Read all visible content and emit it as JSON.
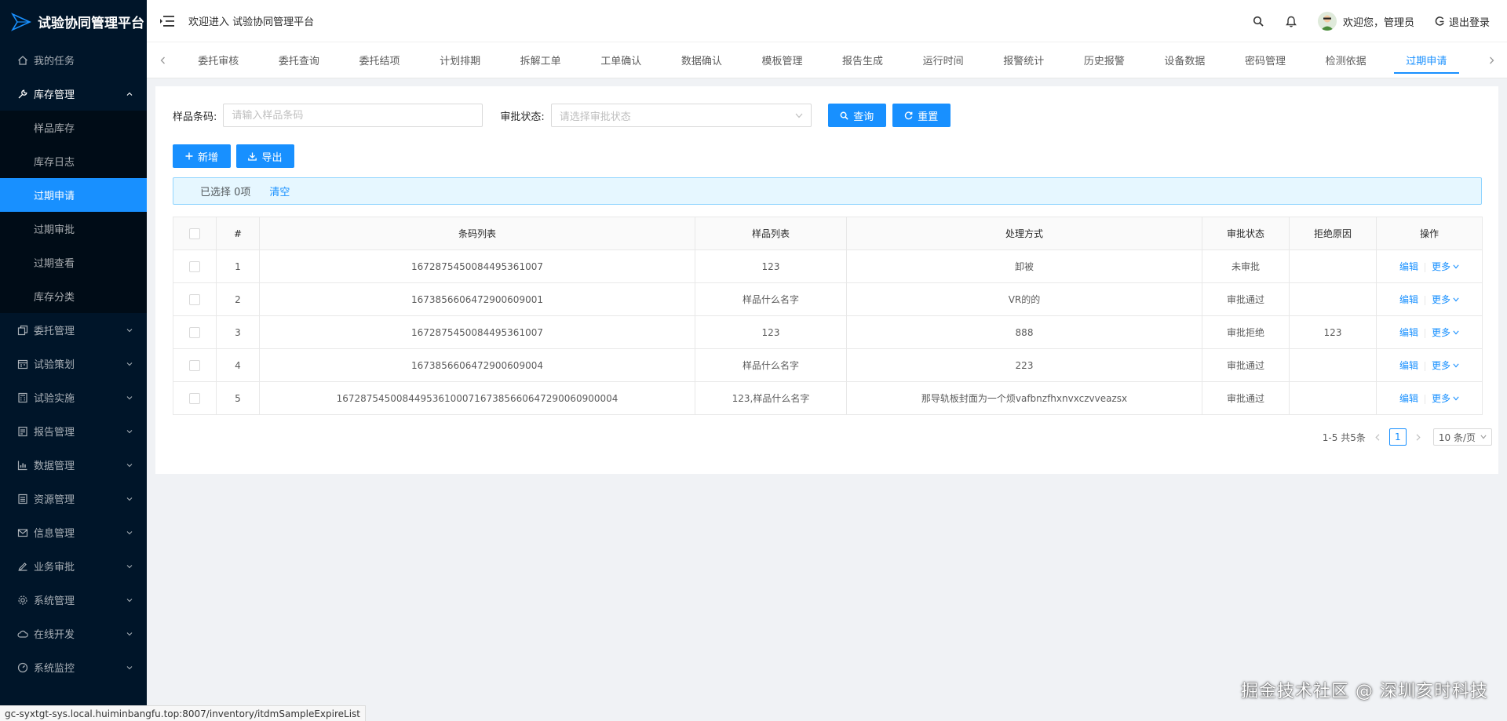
{
  "app": {
    "title": "试验协同管理平台"
  },
  "sidebar": {
    "items": [
      {
        "label": "我的任务",
        "icon": "home-icon",
        "expandable": false
      },
      {
        "label": "库存管理",
        "icon": "wrench-icon",
        "expandable": true,
        "open": true,
        "children": [
          {
            "label": "样品库存",
            "active": false
          },
          {
            "label": "库存日志",
            "active": false
          },
          {
            "label": "过期申请",
            "active": true
          },
          {
            "label": "过期审批",
            "active": false
          },
          {
            "label": "过期查看",
            "active": false
          },
          {
            "label": "库存分类",
            "active": false
          }
        ]
      },
      {
        "label": "委托管理",
        "icon": "copy-icon",
        "expandable": true
      },
      {
        "label": "试验策划",
        "icon": "calendar-icon",
        "expandable": true
      },
      {
        "label": "试验实施",
        "icon": "calculator-icon",
        "expandable": true
      },
      {
        "label": "报告管理",
        "icon": "report-icon",
        "expandable": true
      },
      {
        "label": "数据管理",
        "icon": "chart-icon",
        "expandable": true
      },
      {
        "label": "资源管理",
        "icon": "list-icon",
        "expandable": true
      },
      {
        "label": "信息管理",
        "icon": "mail-icon",
        "expandable": true
      },
      {
        "label": "业务审批",
        "icon": "signature-icon",
        "expandable": true
      },
      {
        "label": "系统管理",
        "icon": "gear-icon",
        "expandable": true
      },
      {
        "label": "在线开发",
        "icon": "cloud-icon",
        "expandable": true
      },
      {
        "label": "系统监控",
        "icon": "dashboard-icon",
        "expandable": true
      }
    ]
  },
  "header": {
    "welcome": "欢迎进入 试验协同管理平台",
    "user_greeting": "欢迎您，管理员",
    "logout_label": "退出登录"
  },
  "tabs": [
    {
      "label": "委托审核",
      "active": false
    },
    {
      "label": "委托查询",
      "active": false
    },
    {
      "label": "委托结项",
      "active": false
    },
    {
      "label": "计划排期",
      "active": false
    },
    {
      "label": "拆解工单",
      "active": false
    },
    {
      "label": "工单确认",
      "active": false
    },
    {
      "label": "数据确认",
      "active": false
    },
    {
      "label": "模板管理",
      "active": false
    },
    {
      "label": "报告生成",
      "active": false
    },
    {
      "label": "运行时间",
      "active": false
    },
    {
      "label": "报警统计",
      "active": false
    },
    {
      "label": "历史报警",
      "active": false
    },
    {
      "label": "设备数据",
      "active": false
    },
    {
      "label": "密码管理",
      "active": false
    },
    {
      "label": "检测依据",
      "active": false
    },
    {
      "label": "过期申请",
      "active": true
    }
  ],
  "search": {
    "barcode_label": "样品条码:",
    "barcode_placeholder": "请输入样品条码",
    "status_label": "审批状态:",
    "status_placeholder": "请选择审批状态",
    "query_label": "查询",
    "reset_label": "重置"
  },
  "toolbar": {
    "add_label": "新增",
    "export_label": "导出"
  },
  "alert": {
    "selected_text": "已选择 0项",
    "clear_label": "清空"
  },
  "table": {
    "columns": [
      "#",
      "条码列表",
      "样品列表",
      "处理方式",
      "审批状态",
      "拒绝原因",
      "操作"
    ],
    "rows": [
      {
        "index": "1",
        "barcode": "1672875450084495361007",
        "sample": "123",
        "method": "卸被",
        "status": "未审批",
        "reason": ""
      },
      {
        "index": "2",
        "barcode": "1673856606472900609001",
        "sample": "样品什么名字",
        "method": "VR的的",
        "status": "审批通过",
        "reason": ""
      },
      {
        "index": "3",
        "barcode": "1672875450084495361007",
        "sample": "123",
        "method": "888",
        "status": "审批拒绝",
        "reason": "123"
      },
      {
        "index": "4",
        "barcode": "1673856606472900609004",
        "sample": "样品什么名字",
        "method": "223",
        "status": "审批通过",
        "reason": ""
      },
      {
        "index": "5",
        "barcode": "16728754500844953610007167385660647290060900004",
        "sample": "123,样品什么名字",
        "method": "那导轨板封面为一个烦vafbnzfhxnvxczvveazsx",
        "status": "审批通过",
        "reason": ""
      }
    ],
    "edit_label": "编辑",
    "more_label": "更多"
  },
  "pagination": {
    "total_text": "1-5 共5条",
    "current_page": "1",
    "page_size": "10 条/页"
  },
  "status_bar": {
    "url": "gc-syxtgt-sys.local.huiminbangfu.top:8007/inventory/itdmSampleExpireList"
  },
  "watermark": {
    "text": "掘金技术社区 @ 深圳亥时科技"
  },
  "colors": {
    "primary": "#1890ff",
    "sidebar_bg": "#001529",
    "submenu_bg": "#000c17",
    "alert_bg": "#e6f7ff"
  }
}
